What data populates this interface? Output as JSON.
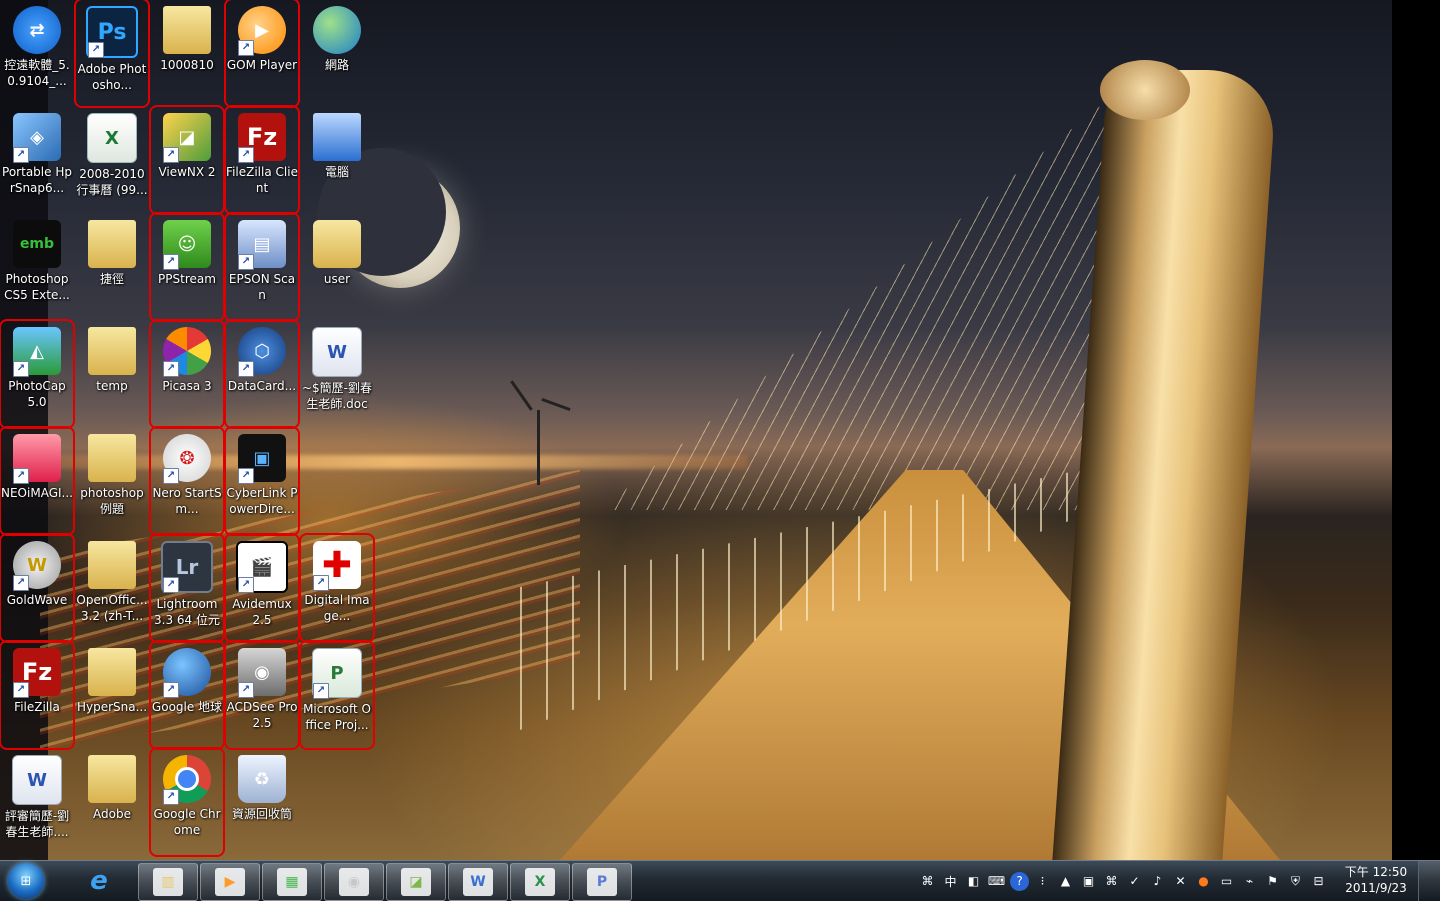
{
  "desktop": {
    "icons": [
      {
        "id": "teamviewer",
        "label": "控遠軟體_5.0.9104_...",
        "glyph": "⇄",
        "marked": false,
        "shortcut": false,
        "icon": "teamviewer-icon"
      },
      {
        "id": "photoshop",
        "label": "Adobe Photosho...",
        "glyph": "Ps",
        "marked": true,
        "shortcut": true,
        "icon": "photoshop-icon"
      },
      {
        "id": "folder-1000810",
        "label": "1000810",
        "glyph": "",
        "marked": false,
        "shortcut": false,
        "icon": "folder-icon"
      },
      {
        "id": "gom-player",
        "label": "GOM Player",
        "glyph": "▶",
        "marked": true,
        "shortcut": true,
        "icon": "gom-player-icon"
      },
      {
        "id": "network",
        "label": "網路",
        "glyph": "",
        "marked": false,
        "shortcut": false,
        "icon": "network-icon"
      },
      {
        "id": "portable-hprsnap",
        "label": "Portable HprSnap6...",
        "glyph": "◈",
        "marked": false,
        "shortcut": true,
        "icon": "hypersnap-icon"
      },
      {
        "id": "calendar-xls",
        "label": "2008-2010行事曆 (99...",
        "glyph": "X",
        "marked": false,
        "shortcut": false,
        "icon": "excel-file-icon"
      },
      {
        "id": "viewnx2",
        "label": "ViewNX 2",
        "glyph": "◪",
        "marked": true,
        "shortcut": true,
        "icon": "viewnx-icon"
      },
      {
        "id": "filezilla-client",
        "label": "FileZilla Client",
        "glyph": "Fz",
        "marked": true,
        "shortcut": true,
        "icon": "filezilla-icon"
      },
      {
        "id": "computer",
        "label": "電腦",
        "glyph": "",
        "marked": false,
        "shortcut": false,
        "icon": "computer-icon"
      },
      {
        "id": "photoshop-cs5-ext",
        "label": "Photoshop CS5 Exte...",
        "glyph": "emb",
        "marked": false,
        "shortcut": false,
        "icon": "emb-icon"
      },
      {
        "id": "shortcut-folder",
        "label": "捷徑",
        "glyph": "",
        "marked": false,
        "shortcut": false,
        "icon": "folder-icon"
      },
      {
        "id": "ppstream",
        "label": "PPStream",
        "glyph": "☺",
        "marked": true,
        "shortcut": true,
        "icon": "ppstream-icon"
      },
      {
        "id": "epson-scan",
        "label": "EPSON Scan",
        "glyph": "▤",
        "marked": true,
        "shortcut": true,
        "icon": "scanner-icon"
      },
      {
        "id": "user-folder",
        "label": "user",
        "glyph": "",
        "marked": false,
        "shortcut": false,
        "icon": "user-folder-icon"
      },
      {
        "id": "photocap",
        "label": "PhotoCap 5.0",
        "glyph": "◭",
        "marked": true,
        "shortcut": true,
        "icon": "photocap-icon"
      },
      {
        "id": "temp-folder",
        "label": "temp",
        "glyph": "",
        "marked": false,
        "shortcut": false,
        "icon": "folder-icon"
      },
      {
        "id": "picasa3",
        "label": "Picasa 3",
        "glyph": "",
        "marked": true,
        "shortcut": true,
        "icon": "picasa-icon"
      },
      {
        "id": "datacard",
        "label": "DataCard...",
        "glyph": "⬡",
        "marked": true,
        "shortcut": true,
        "icon": "datacard-icon"
      },
      {
        "id": "resume-doc",
        "label": "~$簡歷-劉春生老師.doc",
        "glyph": "W",
        "marked": false,
        "shortcut": false,
        "icon": "word-file-icon"
      },
      {
        "id": "neoimaging",
        "label": "NEOiMAGI...",
        "glyph": "",
        "marked": true,
        "shortcut": true,
        "icon": "neoimaging-icon"
      },
      {
        "id": "photoshop-examples",
        "label": "photoshop 例題",
        "glyph": "",
        "marked": false,
        "shortcut": false,
        "icon": "folder-icon"
      },
      {
        "id": "nero-startsmart",
        "label": "Nero StartSm...",
        "glyph": "❂",
        "marked": true,
        "shortcut": true,
        "icon": "nero-icon"
      },
      {
        "id": "cyberlink-powerdirector",
        "label": "CyberLink PowerDire...",
        "glyph": "▣",
        "marked": true,
        "shortcut": true,
        "icon": "powerdirector-icon"
      },
      {
        "id": "goldwave",
        "label": "GoldWave",
        "glyph": "W",
        "marked": true,
        "shortcut": true,
        "icon": "goldwave-icon"
      },
      {
        "id": "openoffice-folder",
        "label": "OpenOffic... 3.2 (zh-T...",
        "glyph": "",
        "marked": false,
        "shortcut": false,
        "icon": "folder-icon"
      },
      {
        "id": "lightroom",
        "label": "Lightroom 3.3 64 位元",
        "glyph": "Lr",
        "marked": true,
        "shortcut": true,
        "icon": "lightroom-icon"
      },
      {
        "id": "avidemux",
        "label": "Avidemux 2.5",
        "glyph": "🎬",
        "marked": true,
        "shortcut": true,
        "icon": "avidemux-icon"
      },
      {
        "id": "digital-image",
        "label": "Digital Image...",
        "glyph": "✚",
        "marked": true,
        "shortcut": true,
        "icon": "digital-image-icon"
      },
      {
        "id": "filezilla",
        "label": "FileZilla",
        "glyph": "Fz",
        "marked": true,
        "shortcut": true,
        "icon": "filezilla-icon"
      },
      {
        "id": "hypersnap-folder",
        "label": "HyperSna...",
        "glyph": "",
        "marked": false,
        "shortcut": false,
        "icon": "folder-icon"
      },
      {
        "id": "google-earth",
        "label": "Google 地球",
        "glyph": "",
        "marked": true,
        "shortcut": true,
        "icon": "google-earth-icon"
      },
      {
        "id": "acdsee",
        "label": "ACDSee Pro 2.5",
        "glyph": "◉",
        "marked": true,
        "shortcut": true,
        "icon": "acdsee-icon"
      },
      {
        "id": "ms-project",
        "label": "Microsoft Office Proj...",
        "glyph": "P",
        "marked": true,
        "shortcut": true,
        "icon": "ms-project-icon"
      },
      {
        "id": "review-doc",
        "label": "評審簡歷-劉春生老師....",
        "glyph": "W",
        "marked": false,
        "shortcut": false,
        "icon": "word-file-icon"
      },
      {
        "id": "adobe-folder",
        "label": "Adobe",
        "glyph": "",
        "marked": false,
        "shortcut": false,
        "icon": "folder-icon"
      },
      {
        "id": "google-chrome",
        "label": "Google Chrome",
        "glyph": "",
        "marked": true,
        "shortcut": true,
        "icon": "chrome-icon"
      },
      {
        "id": "recycle-bin",
        "label": "資源回收筒",
        "glyph": "♻",
        "marked": false,
        "shortcut": false,
        "icon": "recycle-bin-icon"
      }
    ]
  },
  "taskbar": {
    "start_icon": "windows-start-icon",
    "pinned": [
      {
        "id": "ie",
        "icon": "internet-explorer-icon",
        "glyph": "e",
        "color": "#3ea2f0"
      },
      {
        "id": "explorer",
        "icon": "file-explorer-icon",
        "glyph": "▥",
        "color": "#e8c96a"
      },
      {
        "id": "media",
        "icon": "media-player-icon",
        "glyph": "▶",
        "color": "#ff9a2a"
      },
      {
        "id": "monitor",
        "icon": "system-monitor-icon",
        "glyph": "▦",
        "color": "#49b850"
      },
      {
        "id": "acdsee-task",
        "icon": "acdsee-taskbar-icon",
        "glyph": "◉",
        "color": "#c7c7c7"
      },
      {
        "id": "viewnx-task",
        "icon": "viewnx-taskbar-icon",
        "glyph": "◪",
        "color": "#7fb84a"
      },
      {
        "id": "word-task",
        "icon": "word-taskbar-icon",
        "glyph": "W",
        "color": "#3a6fd1"
      },
      {
        "id": "excel-task",
        "icon": "excel-taskbar-icon",
        "glyph": "X",
        "color": "#29924a"
      },
      {
        "id": "project-task",
        "icon": "project-taskbar-icon",
        "glyph": "P",
        "color": "#5a7ad6"
      }
    ],
    "tray": [
      {
        "icon": "ime-icon",
        "glyph": "⌘"
      },
      {
        "icon": "ime-chinese-icon",
        "glyph": "中"
      },
      {
        "icon": "ime-fullwidth-icon",
        "glyph": "◧"
      },
      {
        "icon": "ime-keyboard-icon",
        "glyph": "⌨"
      },
      {
        "icon": "help-icon",
        "glyph": "?"
      },
      {
        "icon": "ime-options-icon",
        "glyph": "⁝"
      },
      {
        "icon": "show-hidden-icons-icon",
        "glyph": "▲"
      },
      {
        "icon": "device-icon",
        "glyph": "▣"
      },
      {
        "icon": "bluetooth-icon",
        "glyph": "⌘"
      },
      {
        "icon": "antivirus-icon",
        "glyph": "✓"
      },
      {
        "icon": "volume-icon",
        "glyph": "♪"
      },
      {
        "icon": "security-icon",
        "glyph": "✕"
      },
      {
        "icon": "orange-app-icon",
        "glyph": "●"
      },
      {
        "icon": "display-icon",
        "glyph": "▭"
      },
      {
        "icon": "network-tray-icon",
        "glyph": "⌁"
      },
      {
        "icon": "action-center-icon",
        "glyph": "⚑"
      },
      {
        "icon": "shield-icon",
        "glyph": "⛨"
      },
      {
        "icon": "power-icon",
        "glyph": "⊟"
      }
    ],
    "clock": {
      "time": "下午 12:50",
      "date": "2011/9/23"
    }
  }
}
